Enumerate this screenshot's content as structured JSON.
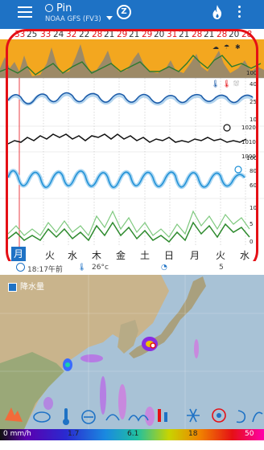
{
  "appbar": {
    "location": "Pin",
    "model": "NOAA GFS (FV3)",
    "zulu_letter": "Z",
    "bg_color": "#1e72c5"
  },
  "icons": {
    "menu": "hamburger-menu-icon",
    "location_pin": "location-pin-icon",
    "dropdown": "chevron-down-icon",
    "zulu": "zulu-time-icon",
    "flame": "flame-icon",
    "overflow": "more-vert-icon"
  },
  "temperatures": [
    "33",
    "25",
    "33",
    "24",
    "32",
    "22",
    "28",
    "21",
    "29",
    "21",
    "29",
    "20",
    "31",
    "21",
    "28",
    "21",
    "28",
    "20",
    "28"
  ],
  "axis_labels": {
    "pressure_top": "1020",
    "pressure_mid": "1010",
    "pressure_bottom": "1000",
    "humidity_top": "100",
    "humidity_mid1": "80",
    "humidity_mid2": "60",
    "wind_top": "10",
    "wind_mid": "5",
    "wind_bottom": "0",
    "temp_top": "40",
    "temp_mid": "25",
    "temp_bottom": "10",
    "sky_bottom": "100"
  },
  "days": [
    "月",
    "火",
    "水",
    "木",
    "金",
    "土",
    "日",
    "月",
    "火",
    "水"
  ],
  "info": {
    "time": "18:17午前",
    "temp": "26°c",
    "wind": "5"
  },
  "map": {
    "layer_label": "降水量"
  },
  "legend": {
    "labels": [
      "0 mm/h",
      "1.7",
      "6.1",
      "18",
      "50"
    ]
  },
  "colors": {
    "frame_red": "#e51016",
    "temp_dark_blue": "#1a5aa8",
    "humidity_blue": "#1e90d6",
    "wind_green": "#3aa33a",
    "sky_orange": "#f3a71f",
    "pressure_black": "#111111"
  }
}
